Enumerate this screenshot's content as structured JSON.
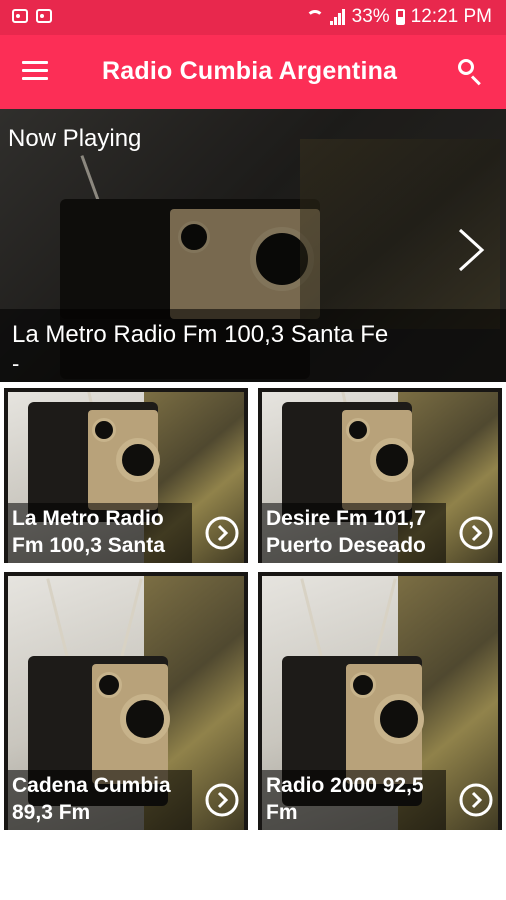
{
  "status_bar": {
    "battery": "33%",
    "time": "12:21 PM"
  },
  "app_bar": {
    "title": "Radio Cumbia Argentina"
  },
  "now_playing": {
    "label": "Now Playing",
    "station": "La Metro Radio Fm 100,3 Santa Fe",
    "subtitle": "-"
  },
  "stations": [
    {
      "line1": "La Metro Radio",
      "line2": "Fm 100,3 Santa"
    },
    {
      "line1": "Desire Fm 101,7",
      "line2": "Puerto Deseado"
    },
    {
      "line1": "Cadena Cumbia",
      "line2": "89,3 Fm"
    },
    {
      "line1": "Radio 2000 92,5",
      "line2": "Fm"
    }
  ],
  "icons": {
    "menu": "menu-icon",
    "search": "search-icon",
    "next": "chevron-right-icon",
    "play": "arrow-circle-right-icon"
  },
  "colors": {
    "status_bar": "#e8284d",
    "app_bar": "#fc2e56"
  }
}
